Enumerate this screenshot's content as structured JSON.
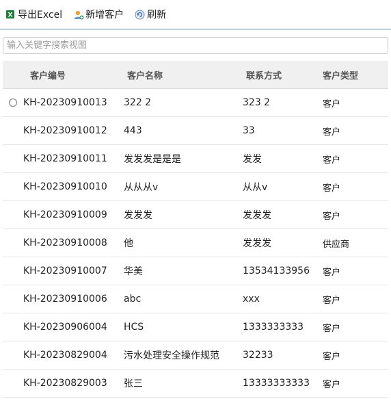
{
  "toolbar": {
    "export_label": "导出Excel",
    "add_label": "新增客户",
    "refresh_label": "刷新"
  },
  "search": {
    "placeholder": "输入关键字搜索视图"
  },
  "table": {
    "headers": [
      "客户编号",
      "客户名称",
      "联系方式",
      "客户类型"
    ],
    "rows": [
      {
        "id": "KH-20230910013",
        "name": "322 2",
        "contact": "323 2",
        "type": "客户"
      },
      {
        "id": "KH-20230910012",
        "name": "443",
        "contact": "33",
        "type": "客户"
      },
      {
        "id": "KH-20230910011",
        "name": "发发发是是是",
        "contact": "发发",
        "type": "客户"
      },
      {
        "id": "KH-20230910010",
        "name": "从从从v",
        "contact": "从从v",
        "type": "客户"
      },
      {
        "id": "KH-20230910009",
        "name": "发发发",
        "contact": "发发发",
        "type": "客户"
      },
      {
        "id": "KH-20230910008",
        "name": "他",
        "contact": "发发发",
        "type": "供应商"
      },
      {
        "id": "KH-20230910007",
        "name": "华美",
        "contact": "13534133956",
        "type": "客户"
      },
      {
        "id": "KH-20230910006",
        "name": "abc",
        "contact": "xxx",
        "type": "客户"
      },
      {
        "id": "KH-20230906004",
        "name": "HCS",
        "contact": "1333333333",
        "type": "客户"
      },
      {
        "id": "KH-20230829004",
        "name": "污水处理安全操作规范",
        "contact": "32233",
        "type": "客户"
      },
      {
        "id": "KH-20230829003",
        "name": "张三",
        "contact": "13333333333",
        "type": "客户"
      }
    ]
  },
  "icons": {
    "excel": "excel-icon",
    "add_user": "add-user-icon",
    "refresh": "refresh-icon"
  },
  "colors": {
    "toolbar_border": "#5b86a6",
    "header_bg": "#f0f0f0",
    "excel_green": "#1e7d3a"
  }
}
